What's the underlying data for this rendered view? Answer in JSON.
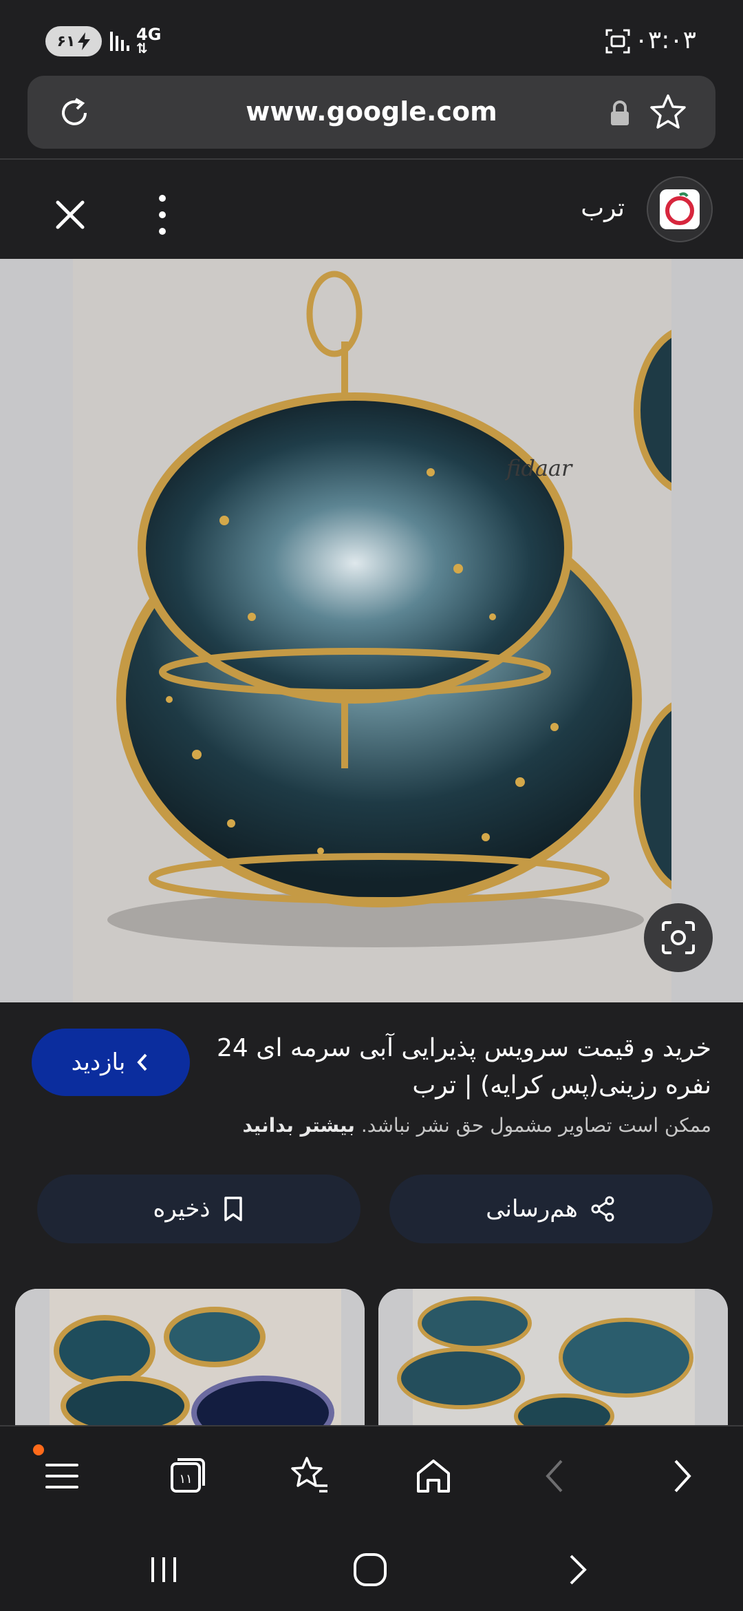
{
  "status_bar": {
    "battery": "۶۱",
    "network": "4G",
    "time": "۰۳:۰۳"
  },
  "browser": {
    "url": "www.google.com"
  },
  "source": {
    "name": "ترب"
  },
  "result": {
    "title": "خرید و قیمت سرویس پذیرایی آبی سرمه ای 24 نفره رزینی(پس کرایه) | ترب",
    "visit_label": "بازدید",
    "copyright_text": "ممکن است تصاویر مشمول حق نشر نباشد.",
    "learn_more": "بیشتر بدانید",
    "share_label": "هم‌رسانی",
    "save_label": "ذخیره",
    "watermark": "fidaar"
  },
  "toolbar": {
    "tab_count": "۱۱"
  },
  "colors": {
    "background": "#1f1f21",
    "visit_button": "#0b2d9e",
    "action_button": "#1e2534",
    "notification_dot": "#ff6a1a"
  },
  "icons": {
    "reload": "reload-icon",
    "lock": "lock-icon",
    "bookmark": "star-icon",
    "close": "close-icon",
    "more": "more-vertical-icon",
    "lens": "lens-icon",
    "share": "share-icon",
    "save": "bookmark-icon"
  }
}
